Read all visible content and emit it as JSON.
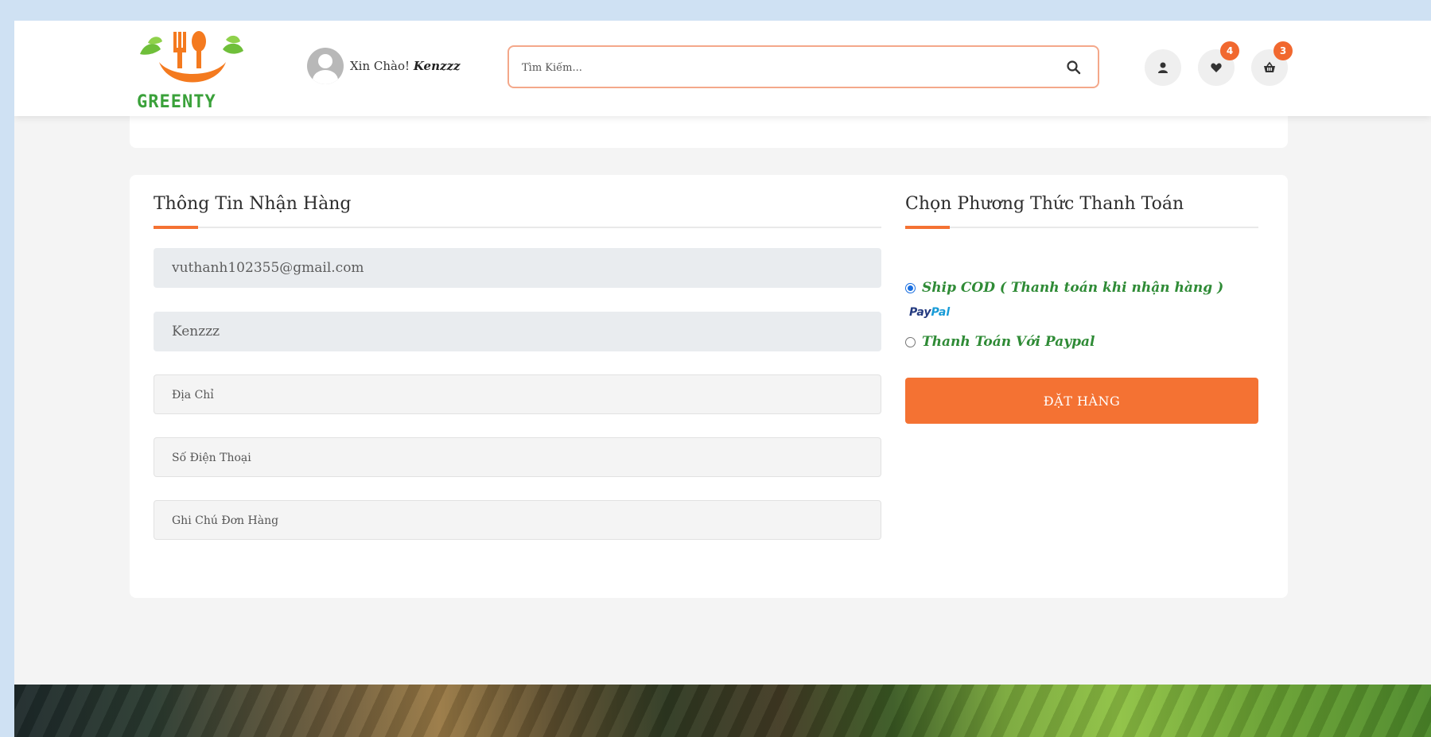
{
  "header": {
    "logo_text": "GREENTY",
    "greeting_prefix": "Xin Chào!",
    "user_name": "Kenzzz",
    "search_placeholder": "Tìm Kiếm...",
    "wishlist_count": "4",
    "cart_count": "3"
  },
  "shipping": {
    "title": "Thông Tin Nhận Hàng",
    "email_value": "vuthanh102355@gmail.com",
    "name_value": "Kenzzz",
    "address_placeholder": "Địa Chỉ",
    "phone_placeholder": "Số Điện Thoại",
    "note_placeholder": "Ghi Chú Đơn Hàng"
  },
  "payment": {
    "title": "Chọn Phương Thức Thanh Toán",
    "options": [
      {
        "label": "Ship COD ( Thanh toán khi nhận hàng )",
        "selected": true
      },
      {
        "label": "Thanh Toán Với Paypal",
        "selected": false
      }
    ],
    "paypal_logo_part1": "Pay",
    "paypal_logo_part2": "Pal",
    "order_button": "ĐẶT HÀNG"
  },
  "colors": {
    "accent": "#f47233",
    "green": "#2f8b36",
    "page_bg": "#cfe1f3"
  }
}
